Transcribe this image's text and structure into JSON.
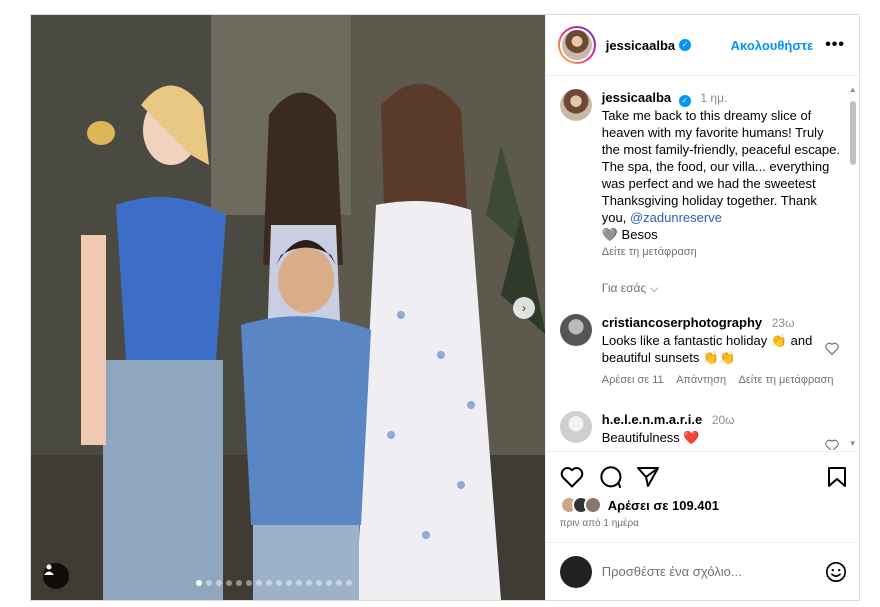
{
  "post": {
    "username": "jessicaalba",
    "follow_label": "Ακολουθήστε",
    "more_label": "•••",
    "caption_time": "1 ημ.",
    "caption_text": "Take me back to this dreamy slice of heaven with my favorite humans! Truly the most family-friendly, peaceful escape. The spa, the food, our villa... everything was perfect and we had the sweetest Thanksgiving holiday together. Thank you,",
    "caption_mention": "@zadunreserve",
    "caption_end": "🩶 Besos",
    "see_translation": "Δείτε τη μετάφραση",
    "for_you": "Για εσάς ⌵"
  },
  "comments": [
    {
      "user": "cristiancoserphotography",
      "time": "23ω",
      "text": "Looks like a fantastic holiday 👏 and beautiful sunsets 👏👏",
      "likes": "Αρέσει σε 11",
      "reply": "Απάντηση",
      "translate": "Δείτε τη μετάφραση"
    },
    {
      "user": "h.e.l.e.n.m.a.r.i.e",
      "time": "20ω",
      "text": "Beautifulness ❤️"
    }
  ],
  "likes_text": "Αρέσει σε 109.401",
  "posted_ago": "πριν από 1 ημέρα",
  "add_comment_placeholder": "Προσθέστε ένα σχόλιο...",
  "carousel": {
    "total_slides": 16,
    "active_slide": 1
  },
  "colors": {
    "accent": "#0095f6",
    "like_red": "#ed4956"
  },
  "icons": [
    "verified-badge-icon",
    "more-icon",
    "heart-icon",
    "comment-icon",
    "share-icon",
    "bookmark-icon",
    "emoji-icon",
    "next-arrow-icon",
    "user-tag-icon"
  ]
}
